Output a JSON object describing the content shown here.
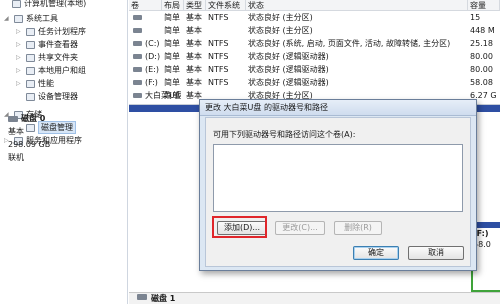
{
  "tree": {
    "items": [
      {
        "label": "计算机管理(本地)",
        "depth": 0,
        "arrow": "",
        "selected": false,
        "icon": "computer-icon"
      },
      {
        "label": "系统工具",
        "depth": 1,
        "arrow": "◢",
        "selected": false,
        "icon": "tools-icon"
      },
      {
        "label": "任务计划程序",
        "depth": 2,
        "arrow": "▷",
        "selected": false,
        "icon": "clock-icon"
      },
      {
        "label": "事件查看器",
        "depth": 2,
        "arrow": "▷",
        "selected": false,
        "icon": "event-icon"
      },
      {
        "label": "共享文件夹",
        "depth": 2,
        "arrow": "▷",
        "selected": false,
        "icon": "folder-icon"
      },
      {
        "label": "本地用户和组",
        "depth": 2,
        "arrow": "▷",
        "selected": false,
        "icon": "users-icon"
      },
      {
        "label": "性能",
        "depth": 2,
        "arrow": "▷",
        "selected": false,
        "icon": "performance-icon"
      },
      {
        "label": "设备管理器",
        "depth": 2,
        "arrow": "",
        "selected": false,
        "icon": "device-icon"
      },
      {
        "label": "存储",
        "depth": 1,
        "arrow": "◢",
        "selected": false,
        "icon": "storage-icon"
      },
      {
        "label": "磁盘管理",
        "depth": 2,
        "arrow": "",
        "selected": true,
        "icon": "disk-icon"
      },
      {
        "label": "服务和应用程序",
        "depth": 1,
        "arrow": "▷",
        "selected": false,
        "icon": "services-icon"
      }
    ]
  },
  "volumes": {
    "headers": [
      "卷",
      "布局",
      "类型",
      "文件系统",
      "状态",
      "容量"
    ],
    "rows": [
      {
        "name": "",
        "layout": "简单",
        "type": "基本",
        "fs": "NTFS",
        "status": "状态良好 (主分区)",
        "size": "15"
      },
      {
        "name": "",
        "layout": "简单",
        "type": "基本",
        "fs": "",
        "status": "状态良好 (主分区)",
        "size": "448 M"
      },
      {
        "name": "(C:)",
        "layout": "简单",
        "type": "基本",
        "fs": "NTFS",
        "status": "状态良好 (系统, 启动, 页面文件, 活动, 故障转储, 主分区)",
        "size": "25.18"
      },
      {
        "name": "(D:)",
        "layout": "简单",
        "type": "基本",
        "fs": "NTFS",
        "status": "状态良好 (逻辑驱动器)",
        "size": "80.00"
      },
      {
        "name": "(E:)",
        "layout": "简单",
        "type": "基本",
        "fs": "NTFS",
        "status": "状态良好 (逻辑驱动器)",
        "size": "80.00"
      },
      {
        "name": "(F:)",
        "layout": "简单",
        "type": "基本",
        "fs": "NTFS",
        "status": "状态良好 (逻辑驱动器)",
        "size": "58.08"
      },
      {
        "name": "大白菜U盘",
        "layout": "简单",
        "type": "基本",
        "fs": "",
        "status": "状态良好 (主分区)",
        "size": "6.27 G"
      }
    ]
  },
  "disk0": {
    "name": "磁盘 0",
    "type": "基本",
    "size": "298.09 GB",
    "state": "联机"
  },
  "disk1": {
    "name": "磁盘 1"
  },
  "f_partition": {
    "label": "(F:)",
    "size": "58.0"
  },
  "dialog": {
    "title": "更改 大白菜U盘 的驱动器号和路径",
    "prompt": "可用下列驱动器号和路径访问这个卷(A):",
    "add_label": "添加(D)...",
    "change_label": "更改(C)...",
    "delete_label": "删除(R)",
    "ok_label": "确定",
    "cancel_label": "取消"
  },
  "colors": {
    "primary_partition": "#2e4fa3",
    "logical_drive": "#3fa33a",
    "highlight": "#e0262b"
  }
}
